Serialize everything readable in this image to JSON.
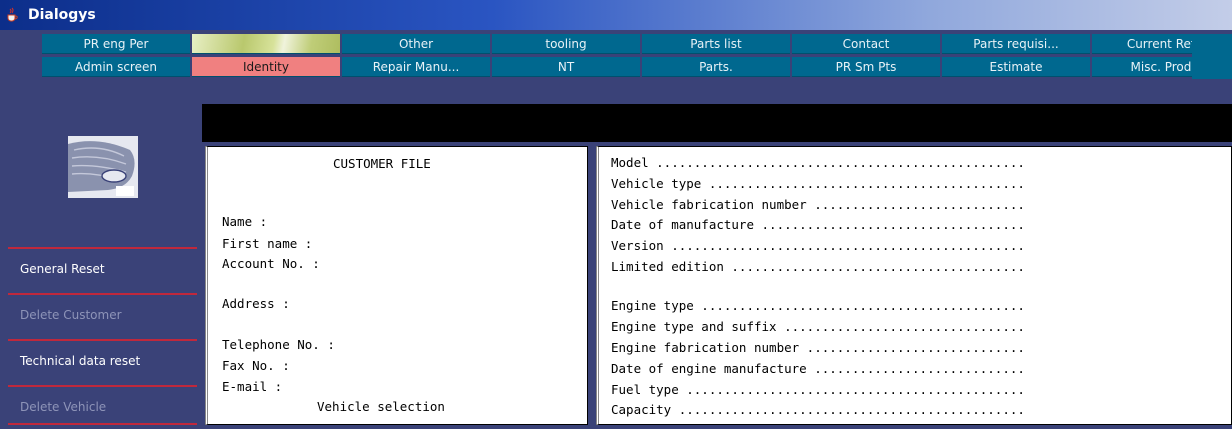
{
  "window": {
    "title": "Dialogys"
  },
  "tabs_row1": [
    "PR eng Per",
    "",
    "Other",
    "tooling",
    "Parts list",
    "Contact",
    "Parts requisi...",
    "Current Refs."
  ],
  "tabs_row2": [
    "Admin screen",
    "Identity",
    "Repair Manu...",
    "NT",
    "Parts.",
    "PR Sm Pts",
    "Estimate",
    "Misc. Prods."
  ],
  "selected_tab": "Identity",
  "colors": {
    "tab": "#00688f",
    "selected_tab": "#f08080",
    "panel": "#3a4278",
    "divider": "#c0283c"
  },
  "sidebar": {
    "items": [
      {
        "label": "General Reset",
        "enabled": true
      },
      {
        "label": "Delete Customer",
        "enabled": false
      },
      {
        "label": "Technical data reset",
        "enabled": true
      },
      {
        "label": "Delete Vehicle",
        "enabled": false
      }
    ]
  },
  "customer_file": {
    "title": "CUSTOMER FILE",
    "name": "Name :",
    "first_name": "First name :",
    "account_no": "Account No. :",
    "address": "Address :",
    "telephone": "Telephone No. :",
    "fax": "Fax No. :",
    "email": "E-mail :",
    "vehicle_selection": "Vehicle selection"
  },
  "vehicle_fields": [
    "Model .................................................",
    "Vehicle type ..........................................",
    "Vehicle fabrication number ............................",
    "Date of manufacture ...................................",
    "Version ...............................................",
    "Limited edition .......................................",
    "",
    "Engine type ...........................................",
    "Engine type and suffix ................................",
    "Engine fabrication number .............................",
    "Date of engine manufacture ............................",
    "Fuel type .............................................",
    "Capacity ..............................................",
    ""
  ],
  "icons": {
    "window_icon": "java-cup-icon",
    "logo": "car-silhouette-icon"
  }
}
